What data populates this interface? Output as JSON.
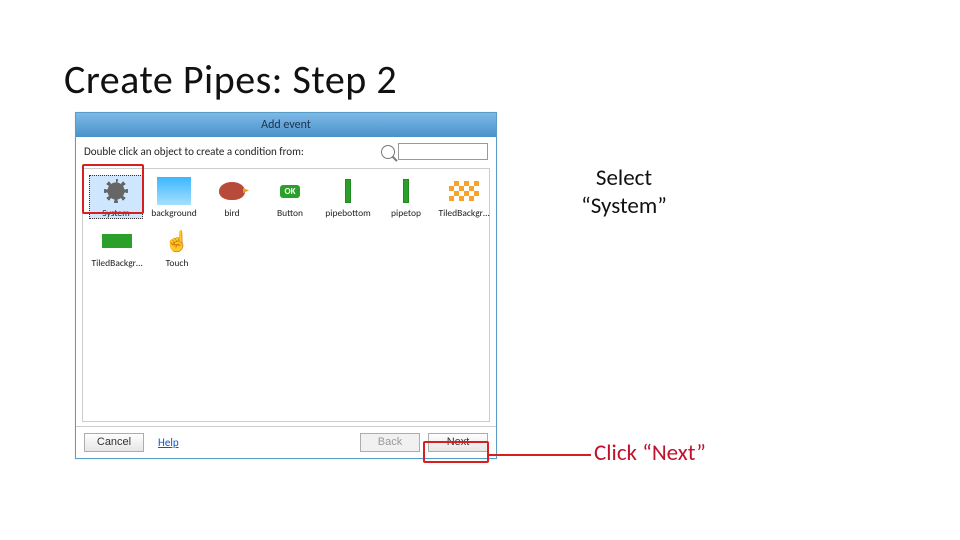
{
  "slide": {
    "title": "Create Pipes: Step 2"
  },
  "dialog": {
    "title": "Add event",
    "prompt": "Double click an object to create a condition from:",
    "search_placeholder": ""
  },
  "objects": {
    "row1": [
      {
        "name": "System"
      },
      {
        "name": "background"
      },
      {
        "name": "bird"
      },
      {
        "name": "Button"
      },
      {
        "name": "pipebottom"
      },
      {
        "name": "pipetop"
      },
      {
        "name": "TiledBackgr…"
      }
    ],
    "row2": [
      {
        "name": "TiledBackgr…"
      },
      {
        "name": "Touch"
      }
    ]
  },
  "footer": {
    "cancel": "Cancel",
    "help": "Help",
    "back": "Back",
    "next": "Next"
  },
  "callouts": {
    "select_line1": "Select",
    "select_line2": "“System”",
    "click_next": "Click “Next”"
  }
}
